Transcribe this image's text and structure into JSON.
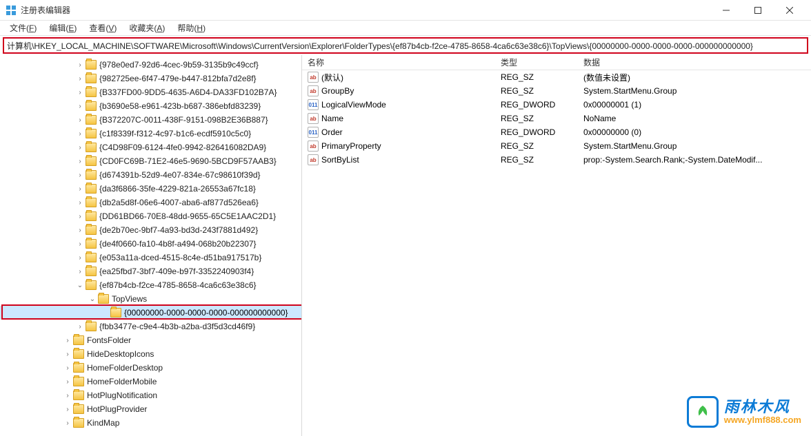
{
  "window": {
    "title": "注册表编辑器"
  },
  "menubar": [
    {
      "label": "文件",
      "accel": "F"
    },
    {
      "label": "编辑",
      "accel": "E"
    },
    {
      "label": "查看",
      "accel": "V"
    },
    {
      "label": "收藏夹",
      "accel": "A"
    },
    {
      "label": "帮助",
      "accel": "H"
    }
  ],
  "address": "计算机\\HKEY_LOCAL_MACHINE\\SOFTWARE\\Microsoft\\Windows\\CurrentVersion\\Explorer\\FolderTypes\\{ef87b4cb-f2ce-4785-8658-4ca6c63e38c6}\\TopViews\\{00000000-0000-0000-0000-000000000000}",
  "tree": {
    "guids": [
      "{978e0ed7-92d6-4cec-9b59-3135b9c49ccf}",
      "{982725ee-6f47-479e-b447-812bfa7d2e8f}",
      "{B337FD00-9DD5-4635-A6D4-DA33FD102B7A}",
      "{b3690e58-e961-423b-b687-386ebfd83239}",
      "{B372207C-0011-438F-9151-098B2E36B887}",
      "{c1f8339f-f312-4c97-b1c6-ecdf5910c5c0}",
      "{C4D98F09-6124-4fe0-9942-826416082DA9}",
      "{CD0FC69B-71E2-46e5-9690-5BCD9F57AAB3}",
      "{d674391b-52d9-4e07-834e-67c98610f39d}",
      "{da3f6866-35fe-4229-821a-26553a67fc18}",
      "{db2a5d8f-06e6-4007-aba6-af877d526ea6}",
      "{DD61BD66-70E8-48dd-9655-65C5E1AAC2D1}",
      "{de2b70ec-9bf7-4a93-bd3d-243f7881d492}",
      "{de4f0660-fa10-4b8f-a494-068b20b22307}",
      "{e053a11a-dced-4515-8c4e-d51ba917517b}",
      "{ea25fbd7-3bf7-409e-b97f-3352240903f4}"
    ],
    "expanded": "{ef87b4cb-f2ce-4785-8658-4ca6c63e38c6}",
    "child": "TopViews",
    "selected": "{00000000-0000-0000-0000-000000000000}",
    "after": "{fbb3477e-c9e4-4b3b-a2ba-d3f5d3cd46f9}",
    "folders": [
      "FontsFolder",
      "HideDesktopIcons",
      "HomeFolderDesktop",
      "HomeFolderMobile",
      "HotPlugNotification",
      "HotPlugProvider",
      "KindMap"
    ]
  },
  "list": {
    "headers": {
      "name": "名称",
      "type": "类型",
      "data": "数据"
    },
    "rows": [
      {
        "icon": "sz",
        "name": "(默认)",
        "type": "REG_SZ",
        "data": "(数值未设置)"
      },
      {
        "icon": "sz",
        "name": "GroupBy",
        "type": "REG_SZ",
        "data": "System.StartMenu.Group"
      },
      {
        "icon": "dw",
        "name": "LogicalViewMode",
        "type": "REG_DWORD",
        "data": "0x00000001 (1)"
      },
      {
        "icon": "sz",
        "name": "Name",
        "type": "REG_SZ",
        "data": "NoName"
      },
      {
        "icon": "dw",
        "name": "Order",
        "type": "REG_DWORD",
        "data": "0x00000000 (0)"
      },
      {
        "icon": "sz",
        "name": "PrimaryProperty",
        "type": "REG_SZ",
        "data": "System.StartMenu.Group"
      },
      {
        "icon": "sz",
        "name": "SortByList",
        "type": "REG_SZ",
        "data": "prop:-System.Search.Rank;-System.DateModif..."
      }
    ]
  },
  "watermark": {
    "cn": "雨林木风",
    "url": "www.ylmf888.com"
  }
}
